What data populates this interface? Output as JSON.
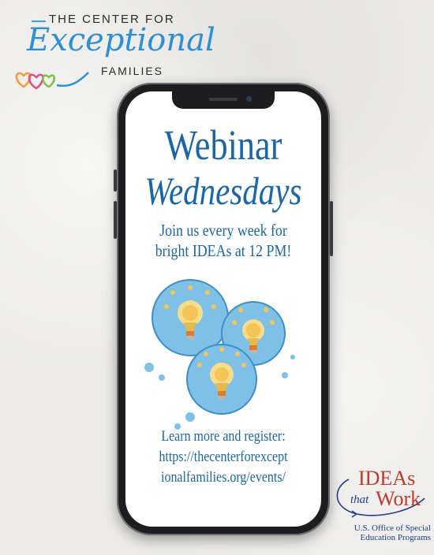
{
  "logo": {
    "top_line": "THE CENTER FOR",
    "script": "Exceptional",
    "bottom_line": "FAMILIES",
    "colors": {
      "blue": "#2d8fd6",
      "orange": "#f39a3b",
      "green": "#7cc24a",
      "pink": "#e44a8b"
    }
  },
  "phone": {
    "title_line1": "Webinar",
    "title_line2": "Wednesdays",
    "tagline_line1": "Join us every week for",
    "tagline_line2": "bright IDEAs at 12 PM!",
    "cta_line1": "Learn more and register:",
    "cta_line2": "https://thecenterforexcept",
    "cta_line3": "ionalfamilies.org/events/",
    "text_color": "#1b66a6",
    "illustration": "three-lightbulbs-thought-bubble"
  },
  "partner_logo": {
    "ideas": "IDEAs",
    "that": "that",
    "work": "Work",
    "sub_line1": "U.S. Office of Special",
    "sub_line2": "Education Programs"
  }
}
